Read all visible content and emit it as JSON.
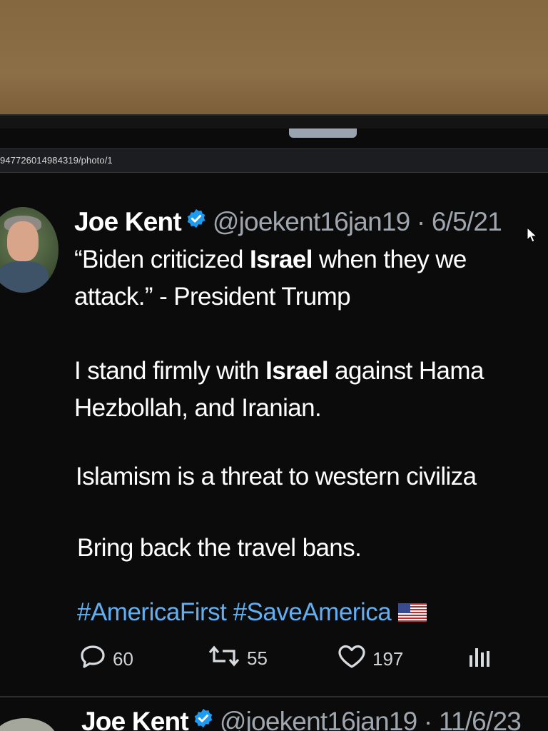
{
  "browser": {
    "url_fragment": "947726014984319/photo/1"
  },
  "tweet": {
    "author_name": "Joe Kent",
    "handle_date": "@joekent16jan19 · 6/5/21",
    "lines": {
      "l1_a": "“Biden criticized ",
      "l1_b": "Israel",
      "l1_c": " when they we",
      "l2": "attack.” - President Trump",
      "l3_a": "I stand firmly with ",
      "l3_b": "Israel",
      "l3_c": " against Hama",
      "l4": "Hezbollah, and Iranian.",
      "l5": "Islamism is a threat to western civiliza",
      "l6": "Bring back the travel bans."
    },
    "hashtags": "#AmericaFirst #SaveAmerica",
    "actions": {
      "replies": "60",
      "retweets": "55",
      "likes": "197"
    }
  },
  "next_tweet": {
    "author_name": "Joe Kent",
    "handle_date": "@joekent16jan19 · 11/6/23"
  },
  "colors": {
    "background": "#0b0b0c",
    "text": "#ffffff",
    "handle": "#a0a6ad",
    "hashtag": "#62aef0",
    "verified": "#1d9bf0"
  },
  "icons": [
    "verified-badge-icon",
    "reply-icon",
    "retweet-icon",
    "like-icon",
    "analytics-icon",
    "us-flag-icon",
    "mouse-cursor-icon"
  ]
}
